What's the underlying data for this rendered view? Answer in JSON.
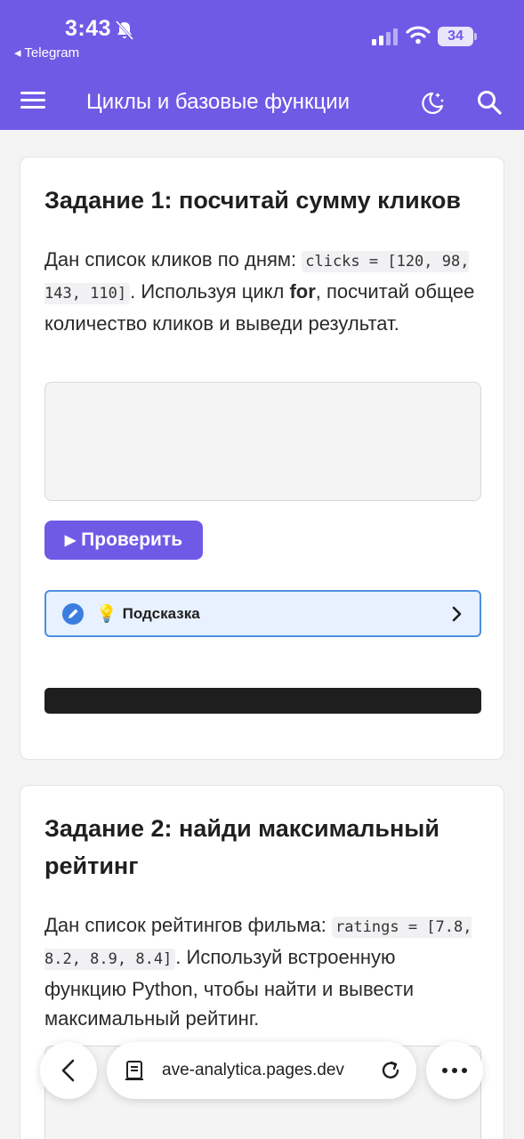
{
  "status_bar": {
    "time": "3:43",
    "back_app": "◂ Telegram",
    "battery": "34"
  },
  "header": {
    "title": "Циклы и базовые функции",
    "menu_icon": "hamburger-menu-icon",
    "theme_icon": "moon-stars-icon",
    "search_icon": "search-icon"
  },
  "task1": {
    "title": "Задание 1: посчитай сумму кликов",
    "text_before": "Дан список кликов по дням: ",
    "code": "clicks = [120, 98, 143, 110]",
    "text_mid": ". Используя цикл ",
    "keyword": "for",
    "text_after": ", посчитай общее количество кликов и выведи результат.",
    "check_label": "Проверить",
    "hint_emoji": "💡",
    "hint_label": "Подсказка"
  },
  "task2": {
    "title": "Задание 2: найди максимальный рейтинг",
    "text_before": "Дан список рейтингов фильма: ",
    "code": "ratings = [7.8, 8.2, 8.9, 8.4]",
    "text_after": ". Используй встроенную функцию Python, чтобы найти и вывести максимальный рейтинг."
  },
  "browser": {
    "url": "ave-analytica.pages.dev"
  },
  "colors": {
    "accent": "#6f5ae6",
    "hint_border": "#4d8fe0",
    "hint_bg": "#e8f1ff",
    "output_bg": "#1e1e1e"
  }
}
